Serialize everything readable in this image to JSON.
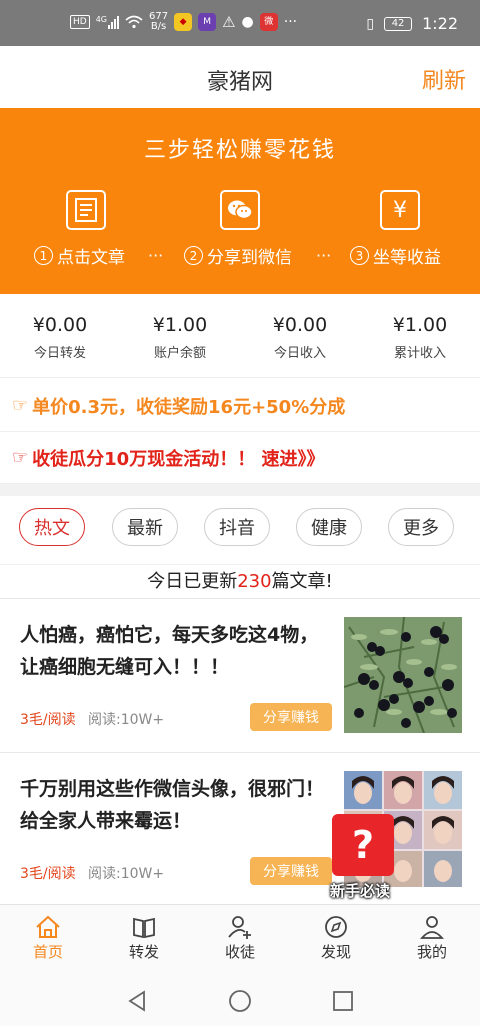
{
  "status_bar": {
    "hd": "HD",
    "network": "4G",
    "speed_value": "677",
    "speed_unit": "B/s",
    "battery": "42",
    "time": "1:22"
  },
  "header": {
    "title": "豪猪网",
    "refresh": "刷新"
  },
  "banner": {
    "slogan": "三步轻松赚零花钱",
    "steps": [
      {
        "num": "1",
        "label": "点击文章"
      },
      {
        "num": "2",
        "label": "分享到微信"
      },
      {
        "num": "3",
        "label": "坐等收益"
      }
    ],
    "separator": "···",
    "yen_symbol": "¥"
  },
  "stats": [
    {
      "value": "¥0.00",
      "label": "今日转发"
    },
    {
      "value": "¥1.00",
      "label": "账户余额"
    },
    {
      "value": "¥0.00",
      "label": "今日收入"
    },
    {
      "value": "¥1.00",
      "label": "累计收入"
    }
  ],
  "notices": [
    {
      "text": "单价0.3元，收徒奖励16元+50%分成",
      "color": "#f5871f"
    },
    {
      "text": "收徒瓜分10万现金活动！！ 速进》》",
      "color": "#e2231a"
    }
  ],
  "tabs": [
    {
      "label": "热文",
      "active": true
    },
    {
      "label": "最新",
      "active": false
    },
    {
      "label": "抖音",
      "active": false
    },
    {
      "label": "健康",
      "active": false
    },
    {
      "label": "更多",
      "active": false
    }
  ],
  "updated": {
    "prefix": "今日已更新",
    "count": "230",
    "suffix": "篇文章!"
  },
  "articles": [
    {
      "title": "人怕癌，癌怕它，每天多吃这4物，让癌细胞无缝可入！！！",
      "price": "3毛/阅读",
      "reads": "阅读:10W+",
      "share": "分享赚钱",
      "thumb_icon": "berries-photo-icon"
    },
    {
      "title": "千万别用这些作微信头像，很邪门！给全家人带来霉运！",
      "price": "3毛/阅读",
      "reads": "阅读:10W+",
      "share": "分享赚钱",
      "thumb_icon": "portraits-photo-icon"
    }
  ],
  "help": {
    "mark": "?",
    "label": "新手必读"
  },
  "bottom_nav": [
    {
      "label": "首页",
      "icon": "home-icon",
      "active": true
    },
    {
      "label": "转发",
      "icon": "book-icon",
      "active": false
    },
    {
      "label": "收徒",
      "icon": "add-user-icon",
      "active": false
    },
    {
      "label": "发现",
      "icon": "compass-icon",
      "active": false
    },
    {
      "label": "我的",
      "icon": "person-icon",
      "active": false
    }
  ],
  "colors": {
    "accent": "#f9850d",
    "active_tab": "#d9322e",
    "highlight_red": "#e2231a",
    "share_button": "#f7b455"
  }
}
